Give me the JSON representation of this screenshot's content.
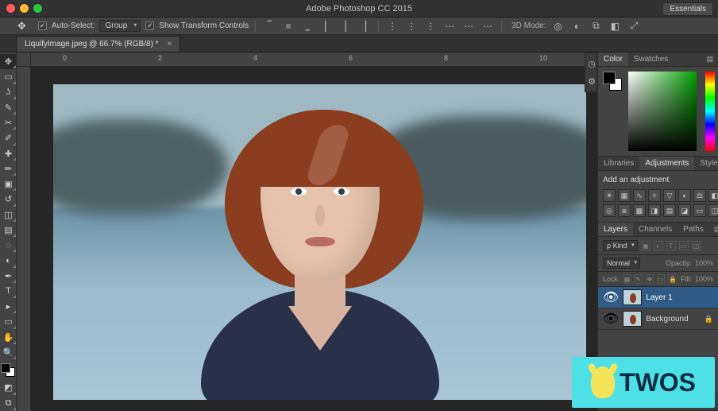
{
  "app": {
    "title": "Adobe Photoshop CC 2015",
    "workspace": "Essentials"
  },
  "options_bar": {
    "auto_select_checked": true,
    "auto_select_label": "Auto-Select:",
    "layer_select_mode": "Group",
    "show_transform_checked": true,
    "show_transform_label": "Show Transform Controls",
    "mode_label": "3D Mode:"
  },
  "document": {
    "tab_label": "LiquifyImage.jpeg @ 66.7% (RGB/8) *"
  },
  "ruler": {
    "marks": [
      "0",
      "2",
      "4",
      "6",
      "8",
      "10"
    ]
  },
  "panels": {
    "color": {
      "tabs": [
        "Color",
        "Swatches"
      ],
      "active": "Color"
    },
    "adjustments": {
      "tabs": [
        "Libraries",
        "Adjustments",
        "Styles"
      ],
      "active": "Adjustments",
      "label": "Add an adjustment"
    },
    "layers": {
      "tabs": [
        "Layers",
        "Channels",
        "Paths"
      ],
      "active": "Layers",
      "filter_mode": "Kind",
      "blend_mode": "Normal",
      "opacity_label": "Opacity:",
      "opacity_value": "100%",
      "lock_label": "Lock:",
      "fill_label": "Fill:",
      "fill_value": "100%",
      "items": [
        {
          "name": "Layer 1",
          "visible": true,
          "selected": true,
          "locked": false
        },
        {
          "name": "Background",
          "visible": true,
          "selected": false,
          "locked": true
        }
      ]
    }
  },
  "watermark": {
    "text": "TWOS"
  }
}
